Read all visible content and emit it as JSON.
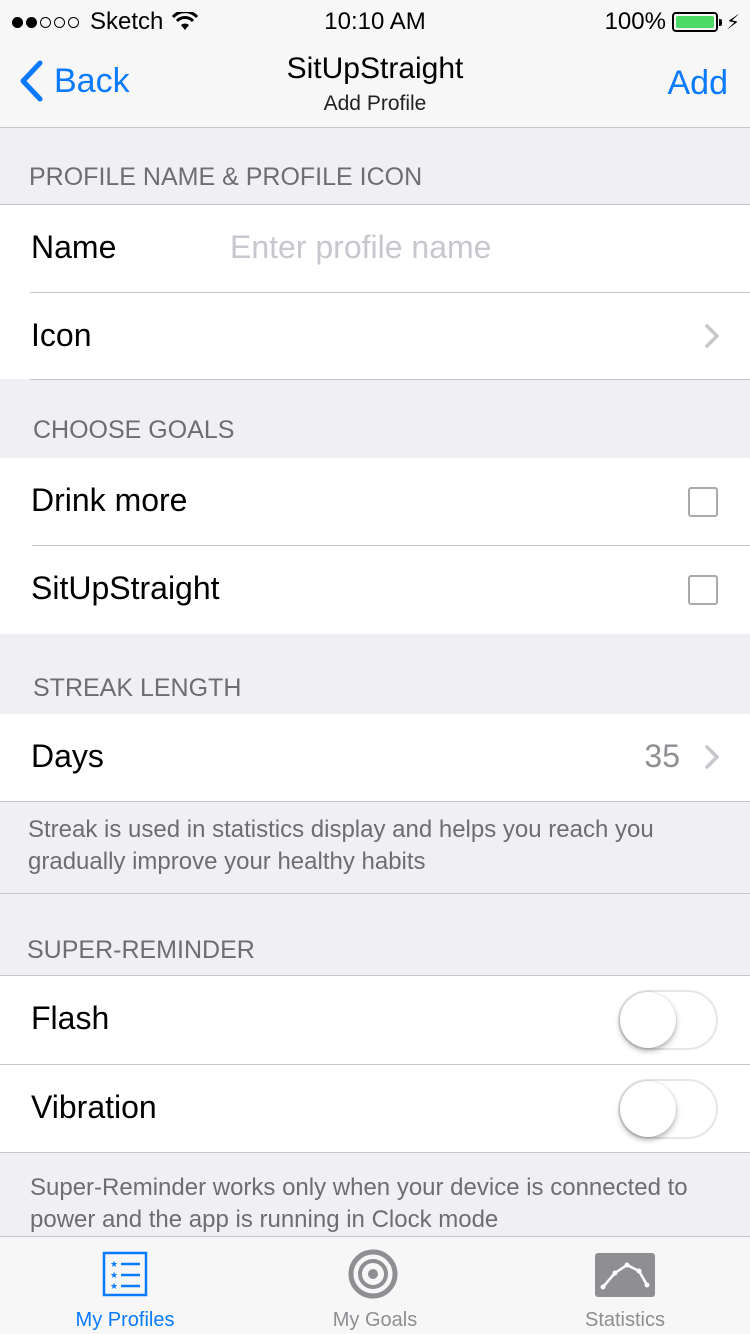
{
  "status_bar": {
    "carrier": "Sketch",
    "time": "10:10 AM",
    "battery": "100%"
  },
  "nav": {
    "back_label": "Back",
    "title": "SitUpStraight",
    "subtitle": "Add Profile",
    "action_label": "Add"
  },
  "sections": {
    "profile_header": "PROFILE NAME & PROFILE ICON",
    "name_label": "Name",
    "name_placeholder": "Enter profile name",
    "icon_label": "Icon",
    "goals_header": "CHOOSE GOALS",
    "goal_1": "Drink more",
    "goal_2": "SitUpStraight",
    "streak_header": "STREAK LENGTH",
    "days_label": "Days",
    "days_value": "35",
    "streak_note": "Streak is used in statistics display and helps you reach you gradually improve your healthy habits",
    "reminder_header": "SUPER-REMINDER",
    "flash_label": "Flash",
    "vibration_label": "Vibration",
    "reminder_note": "Super-Reminder works only when your device is connected to power and the app is running in Clock mode"
  },
  "tabbar": {
    "tab_profiles": "My Profiles",
    "tab_goals": "My Goals",
    "tab_statistics": "Statistics"
  },
  "colors": {
    "accent": "#0a7aff",
    "battery": "#4cd964",
    "background": "#efeff4"
  }
}
